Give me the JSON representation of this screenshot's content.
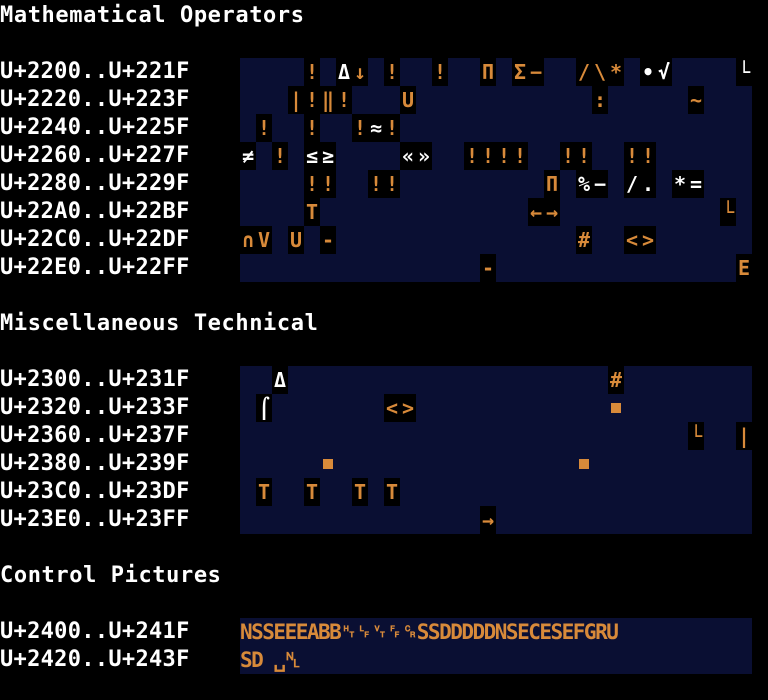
{
  "sections": [
    {
      "title": "Mathematical Operators",
      "rows": [
        {
          "label": "U+2200..U+221F",
          "glyphs": [
            {
              "c": 4,
              "t": "!",
              "k": "o"
            },
            {
              "c": 6,
              "t": "Δ",
              "k": "w"
            },
            {
              "c": 7,
              "t": "↓",
              "k": "o"
            },
            {
              "c": 9,
              "t": "!",
              "k": "o"
            },
            {
              "c": 12,
              "t": "!",
              "k": "o"
            },
            {
              "c": 15,
              "t": "Π",
              "k": "o"
            },
            {
              "c": 17,
              "t": "Σ",
              "k": "o"
            },
            {
              "c": 18,
              "t": "−",
              "k": "o"
            },
            {
              "c": 21,
              "t": "/",
              "k": "o"
            },
            {
              "c": 22,
              "t": "\\",
              "k": "o"
            },
            {
              "c": 23,
              "t": "*",
              "k": "o"
            },
            {
              "c": 25,
              "t": "•",
              "k": "w"
            },
            {
              "c": 26,
              "t": "√",
              "k": "w"
            },
            {
              "c": 31,
              "t": "└",
              "k": "w"
            }
          ]
        },
        {
          "label": "U+2220..U+223F",
          "glyphs": [
            {
              "c": 3,
              "t": "|",
              "k": "o"
            },
            {
              "c": 4,
              "t": "!",
              "k": "o"
            },
            {
              "c": 5,
              "t": "‖",
              "k": "o"
            },
            {
              "c": 6,
              "t": "!",
              "k": "o"
            },
            {
              "c": 10,
              "t": "U",
              "k": "o"
            },
            {
              "c": 22,
              "t": ":",
              "k": "o"
            },
            {
              "c": 28,
              "t": "~",
              "k": "o"
            }
          ]
        },
        {
          "label": "U+2240..U+225F",
          "glyphs": [
            {
              "c": 1,
              "t": "!",
              "k": "o"
            },
            {
              "c": 4,
              "t": "!",
              "k": "o"
            },
            {
              "c": 7,
              "t": "!",
              "k": "o"
            },
            {
              "c": 8,
              "t": "≈",
              "k": "w"
            },
            {
              "c": 9,
              "t": "!",
              "k": "o"
            }
          ]
        },
        {
          "label": "U+2260..U+227F",
          "glyphs": [
            {
              "c": 0,
              "t": "≠",
              "k": "w"
            },
            {
              "c": 2,
              "t": "!",
              "k": "o"
            },
            {
              "c": 4,
              "t": "≤",
              "k": "w"
            },
            {
              "c": 5,
              "t": "≥",
              "k": "w"
            },
            {
              "c": 10,
              "t": "«",
              "k": "w"
            },
            {
              "c": 11,
              "t": "»",
              "k": "w"
            },
            {
              "c": 14,
              "t": "!",
              "k": "o"
            },
            {
              "c": 15,
              "t": "!",
              "k": "o"
            },
            {
              "c": 16,
              "t": "!",
              "k": "o"
            },
            {
              "c": 17,
              "t": "!",
              "k": "o"
            },
            {
              "c": 20,
              "t": "!",
              "k": "o"
            },
            {
              "c": 21,
              "t": "!",
              "k": "o"
            },
            {
              "c": 24,
              "t": "!",
              "k": "o"
            },
            {
              "c": 25,
              "t": "!",
              "k": "o"
            }
          ]
        },
        {
          "label": "U+2280..U+229F",
          "glyphs": [
            {
              "c": 4,
              "t": "!",
              "k": "o"
            },
            {
              "c": 5,
              "t": "!",
              "k": "o"
            },
            {
              "c": 8,
              "t": "!",
              "k": "o"
            },
            {
              "c": 9,
              "t": "!",
              "k": "o"
            },
            {
              "c": 19,
              "t": "Π",
              "k": "o"
            },
            {
              "c": 21,
              "t": "%",
              "k": "w"
            },
            {
              "c": 22,
              "t": "−",
              "k": "w"
            },
            {
              "c": 24,
              "t": "/",
              "k": "w"
            },
            {
              "c": 25,
              "t": ".",
              "k": "w"
            },
            {
              "c": 27,
              "t": "*",
              "k": "w"
            },
            {
              "c": 28,
              "t": "=",
              "k": "w"
            }
          ]
        },
        {
          "label": "U+22A0..U+22BF",
          "glyphs": [
            {
              "c": 4,
              "t": "T",
              "k": "o"
            },
            {
              "c": 18,
              "t": "←",
              "k": "o"
            },
            {
              "c": 19,
              "t": "→",
              "k": "o"
            },
            {
              "c": 30,
              "t": "└",
              "k": "o"
            }
          ]
        },
        {
          "label": "U+22C0..U+22DF",
          "glyphs": [
            {
              "c": 0,
              "t": "∩",
              "k": "o"
            },
            {
              "c": 1,
              "t": "V",
              "k": "o"
            },
            {
              "c": 3,
              "t": "U",
              "k": "o"
            },
            {
              "c": 5,
              "t": "-",
              "k": "o"
            },
            {
              "c": 21,
              "t": "#",
              "k": "o"
            },
            {
              "c": 24,
              "t": "<",
              "k": "o"
            },
            {
              "c": 25,
              "t": ">",
              "k": "o"
            }
          ]
        },
        {
          "label": "U+22E0..U+22FF",
          "glyphs": [
            {
              "c": 15,
              "t": "-",
              "k": "o"
            },
            {
              "c": 31,
              "t": "E",
              "k": "o"
            }
          ]
        }
      ]
    },
    {
      "title": "Miscellaneous Technical",
      "rows": [
        {
          "label": "U+2300..U+231F",
          "glyphs": [
            {
              "c": 2,
              "t": "Δ",
              "k": "w"
            },
            {
              "c": 23,
              "t": "#",
              "k": "o"
            }
          ]
        },
        {
          "label": "U+2320..U+233F",
          "glyphs": [
            {
              "c": 1,
              "t": "⌠",
              "k": "w"
            },
            {
              "c": 9,
              "t": "<",
              "k": "o"
            },
            {
              "c": 10,
              "t": ">",
              "k": "o"
            },
            {
              "c": 23,
              "t": "■",
              "k": "o"
            }
          ]
        },
        {
          "label": "U+2360..U+237F",
          "glyphs": [
            {
              "c": 28,
              "t": "└",
              "k": "o"
            },
            {
              "c": 31,
              "t": "|",
              "k": "o"
            }
          ]
        },
        {
          "label": "U+2380..U+239F",
          "glyphs": [
            {
              "c": 5,
              "t": "■",
              "k": "o"
            },
            {
              "c": 21,
              "t": "■",
              "k": "o"
            }
          ]
        },
        {
          "label": "U+23C0..U+23DF",
          "glyphs": [
            {
              "c": 1,
              "t": "T",
              "k": "o"
            },
            {
              "c": 4,
              "t": "T",
              "k": "o"
            },
            {
              "c": 7,
              "t": "T",
              "k": "o"
            },
            {
              "c": 9,
              "t": "T",
              "k": "o"
            }
          ]
        },
        {
          "label": "U+23E0..U+23FF",
          "glyphs": [
            {
              "c": 15,
              "t": "→",
              "k": "o"
            }
          ]
        }
      ]
    },
    {
      "title": "Control Pictures",
      "rows": [
        {
          "label": "U+2400..U+241F",
          "text": "NSSEEEABB␉␊␋␌␍SSDDDDDNSECESEFGRU"
        },
        {
          "label": "U+2420..U+243F",
          "text": "SD ␣␤"
        }
      ]
    }
  ]
}
